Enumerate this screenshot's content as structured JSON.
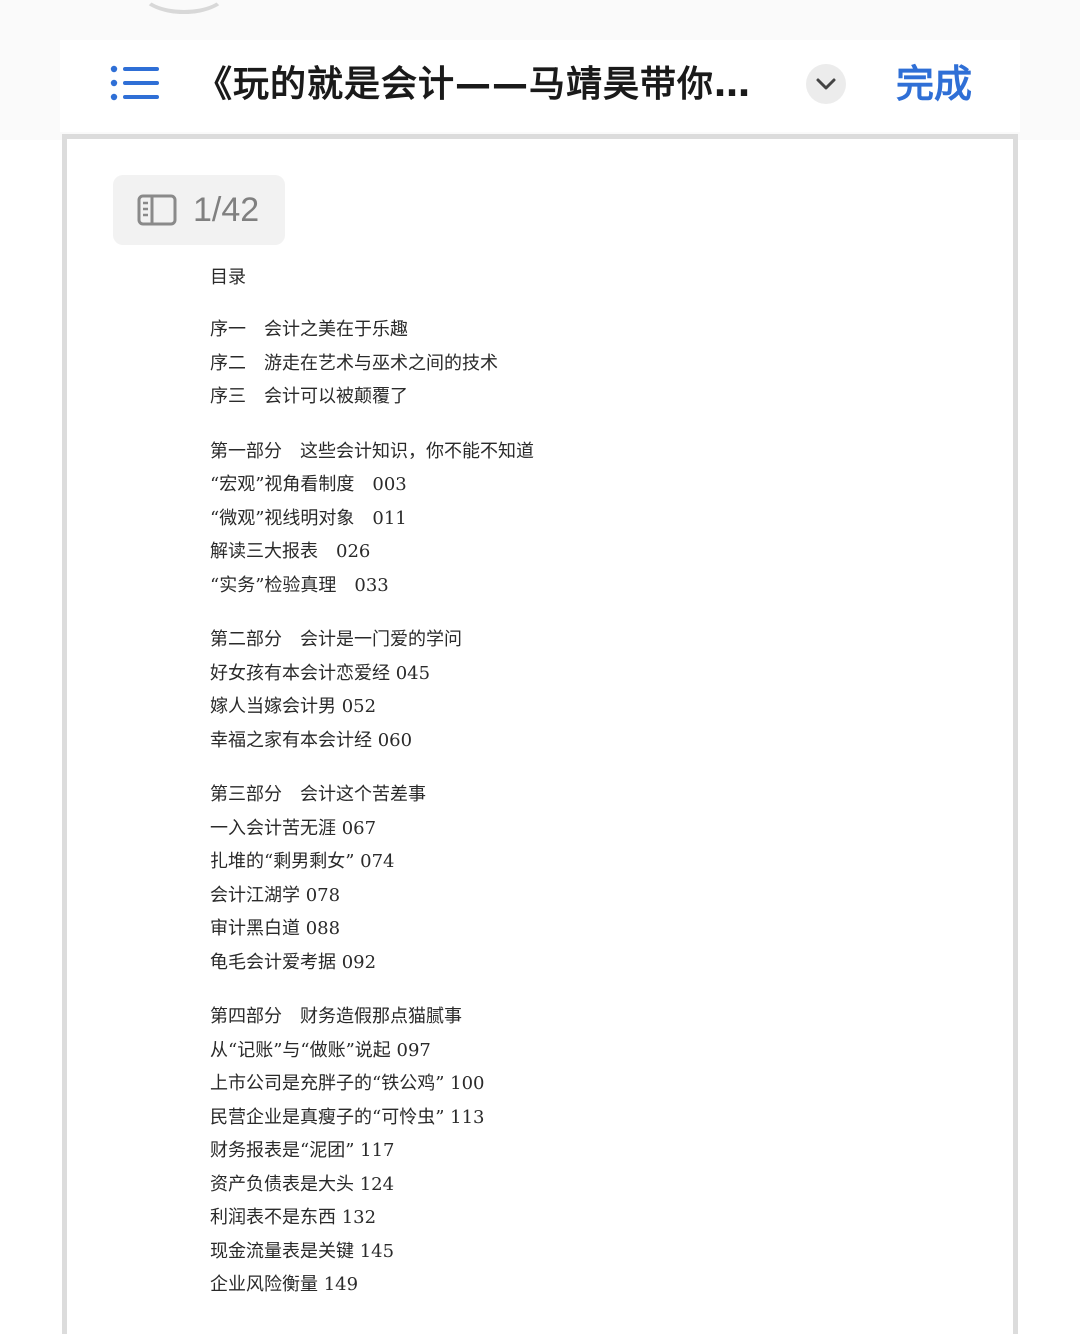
{
  "header": {
    "title": "《玩的就是会计——马靖昊带你…",
    "done_label": "完成"
  },
  "icons": {
    "menu": "list-icon",
    "expand": "chevron-down-icon",
    "page_panel": "sidebar-panel-icon"
  },
  "colors": {
    "accent": "#2f6fd6",
    "title": "#1a1a1a",
    "indicator_bg": "#f2f2f2"
  },
  "page_indicator": {
    "label": "1/42"
  },
  "toc": {
    "heading": "目录",
    "groups": [
      {
        "lines": [
          "序一　会计之美在于乐趣",
          "序二　游走在艺术与巫术之间的技术",
          "序三　会计可以被颠覆了"
        ]
      },
      {
        "lines": [
          "第一部分　这些会计知识，你不能不知道",
          "“宏观”视角看制度　003",
          "“微观”视线明对象　011",
          "解读三大报表　026",
          "“实务”检验真理　033"
        ]
      },
      {
        "lines": [
          "第二部分　会计是一门爱的学问",
          "好女孩有本会计恋爱经 045",
          "嫁人当嫁会计男 052",
          "幸福之家有本会计经 060"
        ]
      },
      {
        "lines": [
          "第三部分　会计这个苦差事",
          "一入会计苦无涯 067",
          "扎堆的“剩男剩女” 074",
          "会计江湖学 078",
          "审计黑白道 088",
          "龟毛会计爱考据 092"
        ]
      },
      {
        "lines": [
          "第四部分　财务造假那点猫腻事",
          "从“记账”与“做账”说起 097",
          "上市公司是充胖子的“铁公鸡” 100",
          "民营企业是真瘦子的“可怜虫” 113",
          "财务报表是“泥团” 117",
          "资产负债表是大头 124",
          "利润表不是东西 132",
          "现金流量表是关键 145",
          "企业风险衡量 149"
        ]
      }
    ]
  }
}
